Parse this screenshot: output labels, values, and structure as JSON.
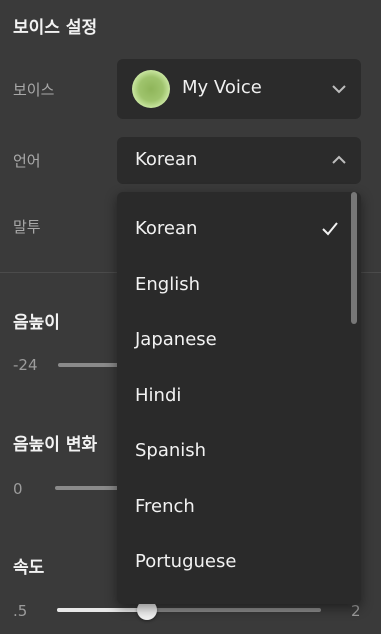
{
  "header": {
    "title": "보이스 설정"
  },
  "voice_row": {
    "label": "보이스",
    "selected": "My Voice"
  },
  "language_row": {
    "label": "언어",
    "selected": "Korean"
  },
  "tone_row": {
    "label": "말투"
  },
  "pitch": {
    "title": "음높이",
    "min_label": "-24"
  },
  "pitch_variation": {
    "title": "음높이 변화",
    "min_label": "0"
  },
  "speed": {
    "title": "속도",
    "min_label": ".5",
    "max_label": "2",
    "value_fraction": 0.34
  },
  "language_dropdown": {
    "options": [
      "Korean",
      "English",
      "Japanese",
      "Hindi",
      "Spanish",
      "French",
      "Portuguese"
    ],
    "selected_index": 0,
    "scroll_position": 0
  },
  "colors": {
    "background": "#3a3a3a",
    "control": "#2b2b2b",
    "avatar_center": "#8fb55a",
    "avatar_glow": "#c9e6a0"
  },
  "icons": [
    "chevron-down-icon",
    "chevron-up-icon",
    "checkmark-icon",
    "voice-avatar-icon"
  ]
}
